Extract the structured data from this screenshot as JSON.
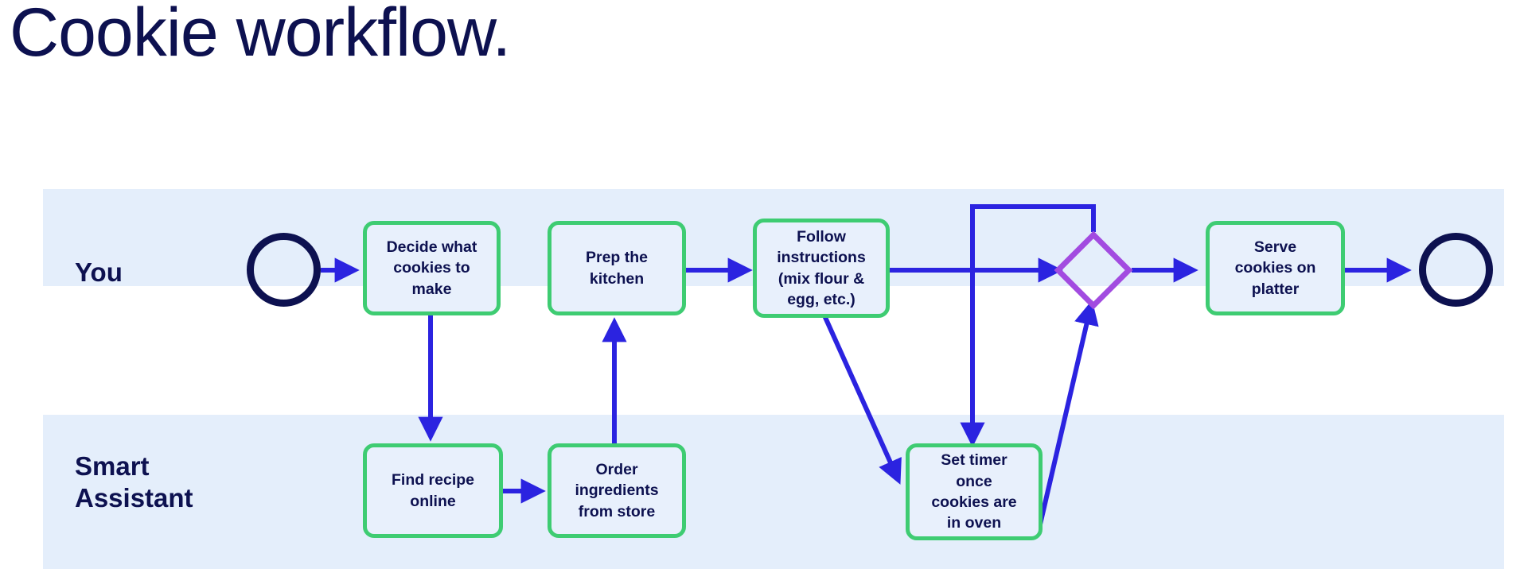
{
  "page": {
    "title": "Cookie workflow.",
    "background_color": "#ffffff"
  },
  "colors": {
    "title_text": "#0D1150",
    "lane_band": "#E4EEFB",
    "task_border": "#3ECC72",
    "task_fill": "#E8F0FC",
    "task_text": "#0D1150",
    "event_border": "#0D1150",
    "gateway_border": "#A24BE0",
    "connector": "#2B23E0"
  },
  "lanes": [
    {
      "id": "you",
      "label": "You"
    },
    {
      "id": "smart_assistant",
      "label": "Smart\nAssistant"
    }
  ],
  "nodes": {
    "start_event": {
      "type": "start-event",
      "lane": "you",
      "label": ""
    },
    "decide": {
      "type": "task",
      "lane": "you",
      "label": "Decide what\ncookies to\nmake"
    },
    "prep": {
      "type": "task",
      "lane": "you",
      "label": "Prep the\nkitchen"
    },
    "follow": {
      "type": "task",
      "lane": "you",
      "label": "Follow\ninstructions\n(mix flour &\negg, etc.)"
    },
    "gateway": {
      "type": "gateway",
      "lane": "you",
      "label": ""
    },
    "serve": {
      "type": "task",
      "lane": "you",
      "label": "Serve\ncookies on\nplatter"
    },
    "end_event": {
      "type": "end-event",
      "lane": "you",
      "label": ""
    },
    "find_recipe": {
      "type": "task",
      "lane": "smart_assistant",
      "label": "Find recipe\nonline"
    },
    "order": {
      "type": "task",
      "lane": "smart_assistant",
      "label": "Order\ningredients\nfrom store"
    },
    "set_timer": {
      "type": "task",
      "lane": "smart_assistant",
      "label": "Set timer\nonce\ncookies are\nin oven"
    }
  },
  "connectors": [
    {
      "from": "start_event",
      "to": "decide",
      "label": ""
    },
    {
      "from": "decide",
      "to": "find_recipe",
      "label": ""
    },
    {
      "from": "find_recipe",
      "to": "order",
      "label": ""
    },
    {
      "from": "order",
      "to": "prep",
      "label": ""
    },
    {
      "from": "prep",
      "to": "follow",
      "label": ""
    },
    {
      "from": "follow",
      "to": "gateway",
      "label": ""
    },
    {
      "from": "follow",
      "to": "set_timer",
      "label": ""
    },
    {
      "from": "set_timer",
      "to": "gateway",
      "label": ""
    },
    {
      "from": "gateway",
      "to": "set_timer",
      "label": ""
    },
    {
      "from": "gateway",
      "to": "serve",
      "label": ""
    },
    {
      "from": "serve",
      "to": "end_event",
      "label": ""
    }
  ]
}
